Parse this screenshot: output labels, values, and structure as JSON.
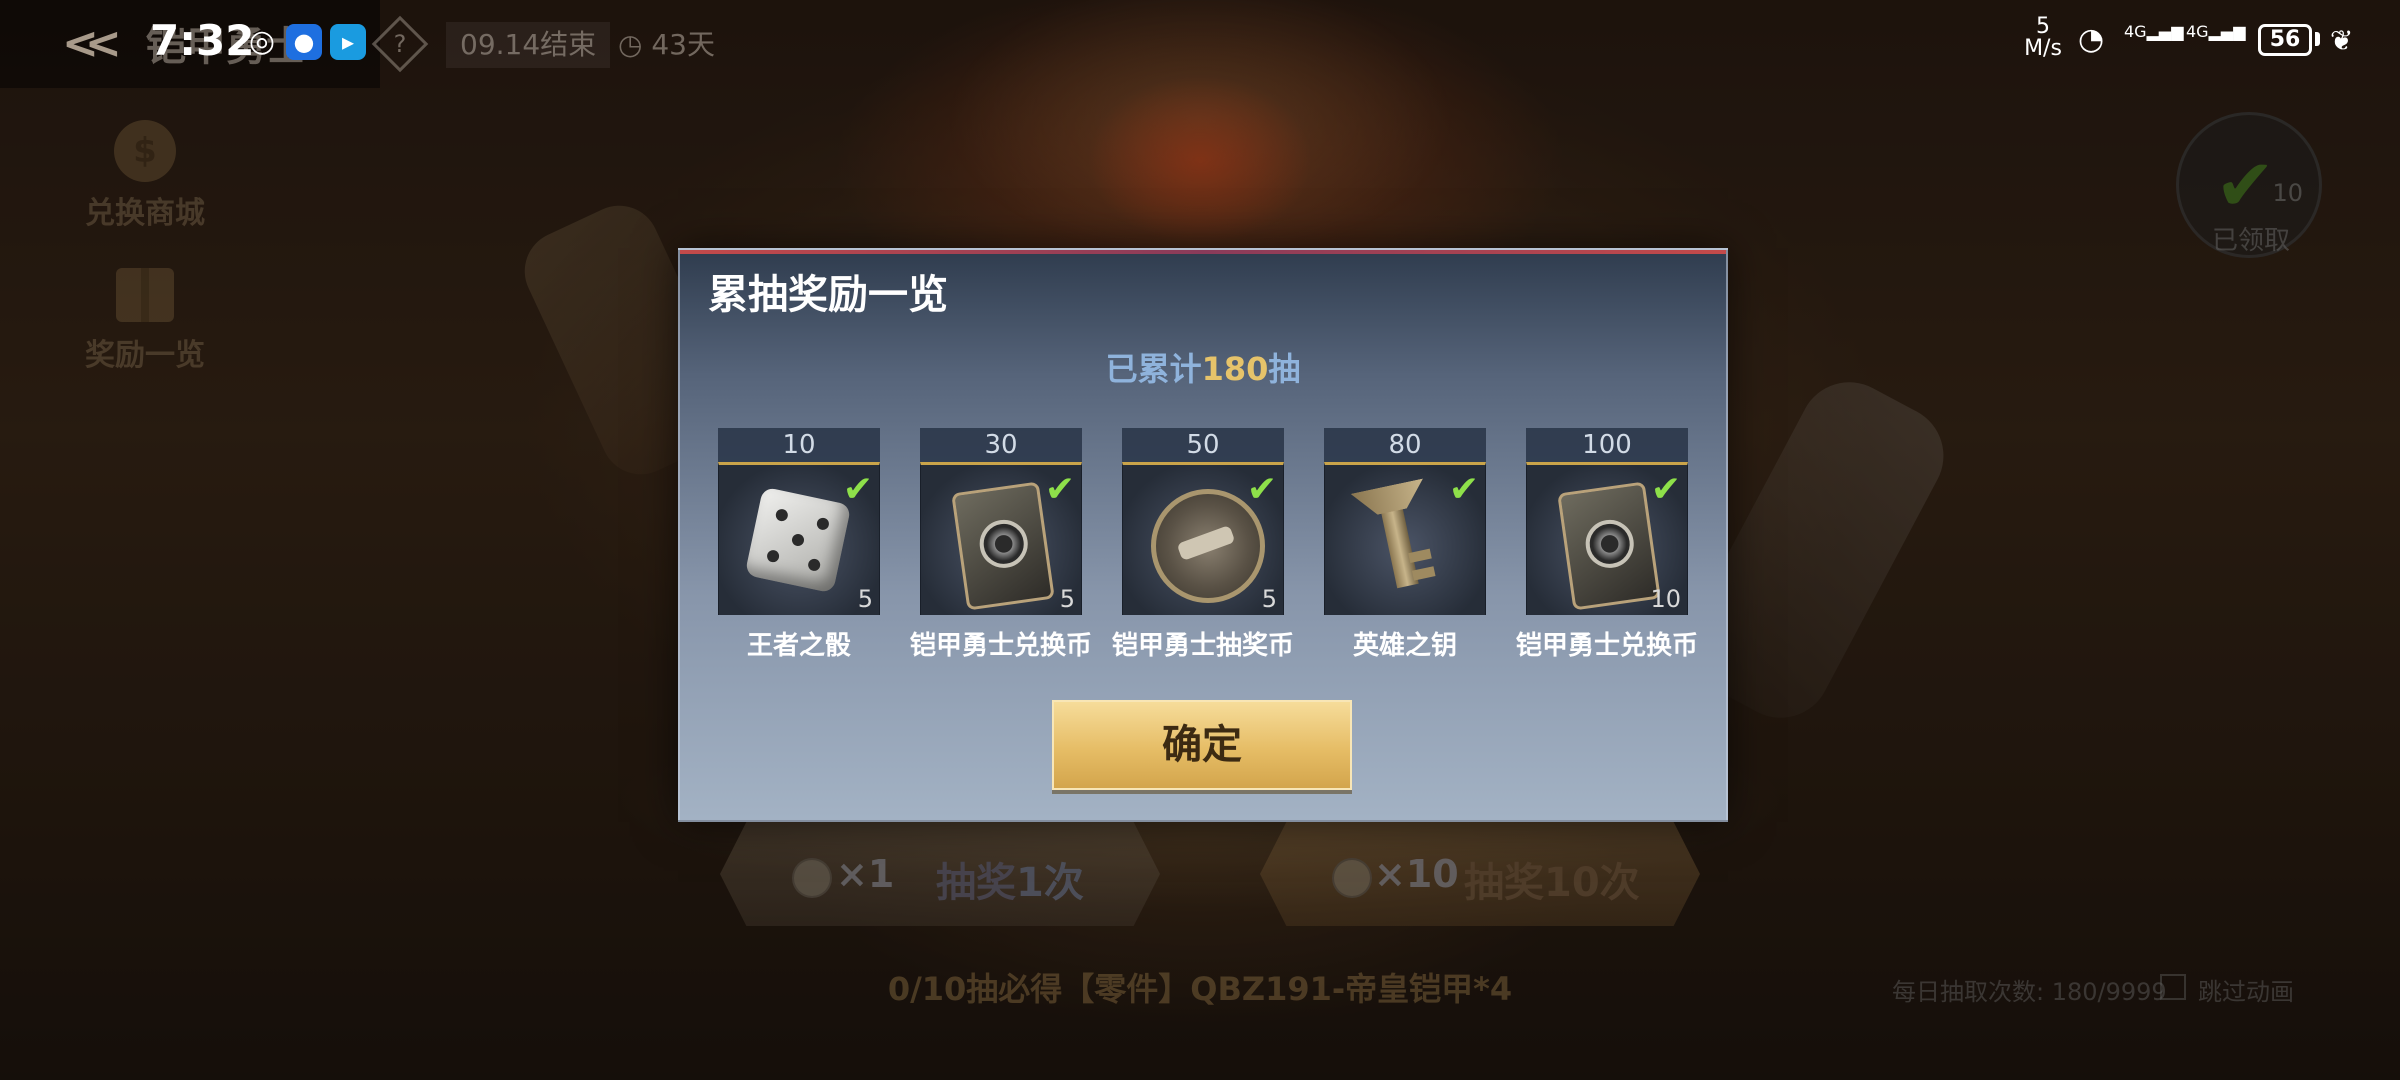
{
  "status_bar": {
    "time": "7:32",
    "network_speed_value": "5",
    "network_speed_unit": "M/s",
    "network_type_1": "4G",
    "network_type_2": "4G",
    "battery": "56"
  },
  "header": {
    "title": "铠甲勇士",
    "deadline": "09.14结束",
    "days_left": "43天"
  },
  "side_menu": {
    "exchange_shop_label": "兑换商城",
    "reward_list_label": "奖励一览"
  },
  "claimed_badge": {
    "count": "10",
    "label": "已领取"
  },
  "modal": {
    "title": "累抽奖励一览",
    "accum_prefix": "已累计",
    "accum_count": "180",
    "accum_suffix": "抽",
    "rewards": [
      {
        "tier": "10",
        "name": "王者之骰",
        "qty": "5",
        "claimed": true,
        "icon": "dice-icon"
      },
      {
        "tier": "30",
        "name": "铠甲勇士兑换币",
        "qty": "5",
        "claimed": true,
        "icon": "exchange-token-icon"
      },
      {
        "tier": "50",
        "name": "铠甲勇士抽奖币",
        "qty": "5",
        "claimed": true,
        "icon": "draw-coin-icon"
      },
      {
        "tier": "80",
        "name": "英雄之钥",
        "qty": "",
        "claimed": true,
        "icon": "key-icon"
      },
      {
        "tier": "100",
        "name": "铠甲勇士兑换币",
        "qty": "10",
        "claimed": true,
        "icon": "exchange-token-icon"
      }
    ],
    "confirm_label": "确定"
  },
  "draw": {
    "single_mult": "×1",
    "single_label_a": "抽奖",
    "single_label_b": "1次",
    "ten_mult": "×10",
    "ten_label_a": "抽奖",
    "ten_label_b": "10次"
  },
  "footer": {
    "guarantee": "0/10抽必得【零件】QBZ191-帝皇铠甲*4",
    "daily_count": "每日抽取次数: 180/9999",
    "skip_animation": "跳过动画"
  },
  "colors": {
    "accent_gold": "#e6bd66",
    "check_green": "#8ee04a",
    "accum_blue": "#8fb3dc",
    "accum_count": "#e6c36a"
  }
}
